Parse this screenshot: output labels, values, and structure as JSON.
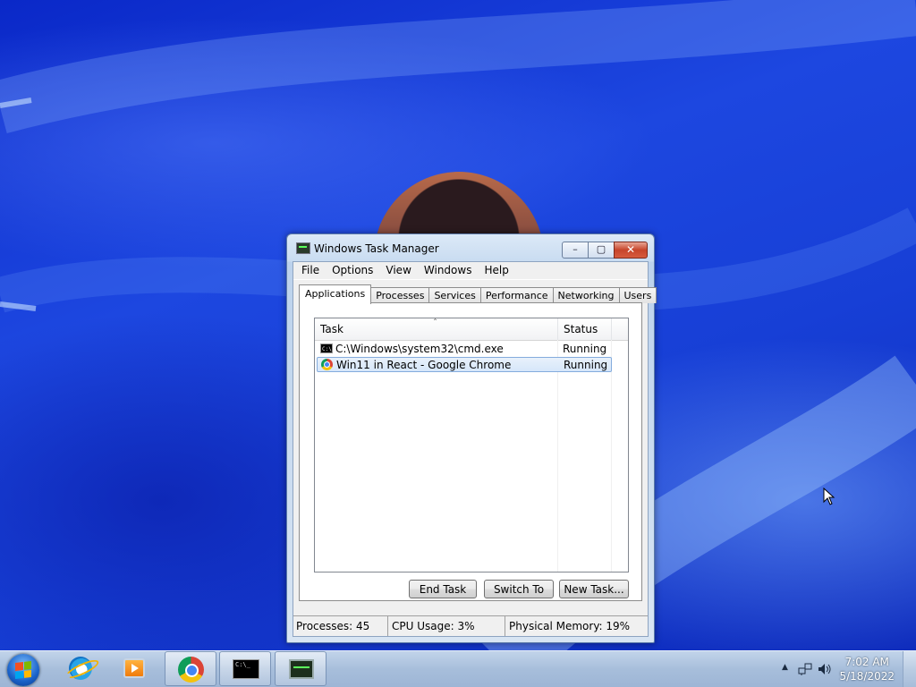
{
  "colors": {
    "desktop": "#1d47e0",
    "selection": "#d6e7fa",
    "close_button": "#c7452b"
  },
  "desktop": {
    "wallpaper": "blue-wave-wallpaper",
    "avatar": "user-avatar-photo"
  },
  "window": {
    "title": "Windows Task Manager",
    "caption_buttons": {
      "minimize": "–",
      "maximize": "▢",
      "close": "✕"
    },
    "menu": [
      "File",
      "Options",
      "View",
      "Windows",
      "Help"
    ],
    "tabs": [
      "Applications",
      "Processes",
      "Services",
      "Performance",
      "Networking",
      "Users"
    ],
    "active_tab": "Applications",
    "list": {
      "columns": {
        "task": "Task",
        "status": "Status"
      },
      "sort_indicator": "ˆ",
      "rows": [
        {
          "task": "C:\\Windows\\system32\\cmd.exe",
          "status": "Running",
          "icon": "cmd-icon"
        },
        {
          "task": "Win11 in React - Google Chrome",
          "status": "Running",
          "icon": "chrome-icon"
        }
      ]
    },
    "buttons": {
      "end_task": "End Task",
      "switch_to": "Switch To",
      "new_task": "New Task..."
    },
    "status_bar": {
      "processes": "Processes: 45",
      "cpu": "CPU Usage: 3%",
      "memory": "Physical Memory: 19%"
    }
  },
  "taskbar": {
    "pinned": [
      "start-orb",
      "internet-explorer-icon",
      "media-player-icon",
      "chrome-icon",
      "cmd-icon",
      "task-manager-icon"
    ],
    "tray": {
      "show_hidden": "▲",
      "time": "7:02 AM",
      "date": "5/18/2022"
    }
  }
}
